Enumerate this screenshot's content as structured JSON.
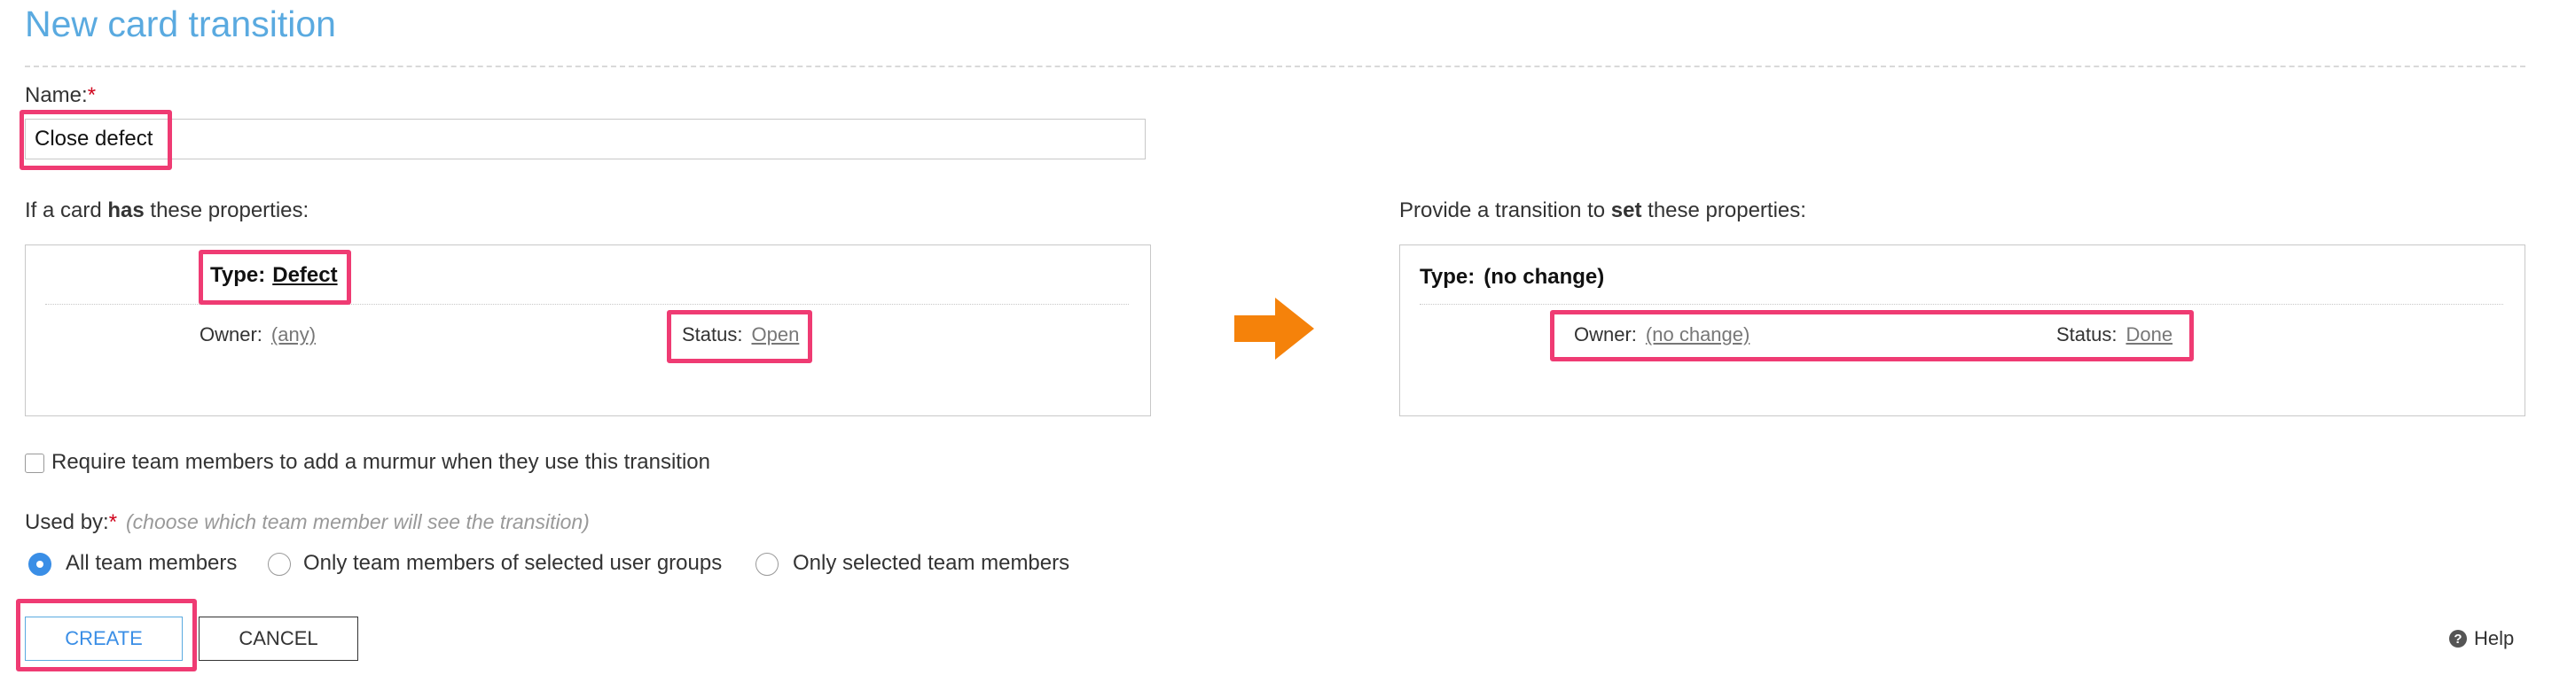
{
  "page": {
    "title": "New card transition"
  },
  "name_field": {
    "label": "Name:",
    "required_mark": "*",
    "value": "Close defect"
  },
  "if_section": {
    "label_before": "If a card ",
    "label_bold": "has",
    "label_after": " these properties:",
    "type_label": "Type:",
    "type_value": "Defect",
    "owner_label": "Owner:",
    "owner_value": "(any)",
    "status_label": "Status:",
    "status_value": "Open"
  },
  "set_section": {
    "label_before": "Provide a transition to ",
    "label_bold": "set",
    "label_after": " these properties:",
    "type_label": "Type:",
    "type_value": "(no change)",
    "owner_label": "Owner:",
    "owner_value": "(no change)",
    "status_label": "Status:",
    "status_value": "Done"
  },
  "murmur": {
    "label": "Require team members to add a murmur when they use this transition",
    "checked": false
  },
  "used_by": {
    "label": "Used by:",
    "required_mark": "*",
    "hint": "(choose which team member will see the transition)",
    "options": [
      {
        "label": "All team members",
        "selected": true
      },
      {
        "label": "Only team members of selected user groups",
        "selected": false
      },
      {
        "label": "Only selected team members",
        "selected": false
      }
    ]
  },
  "actions": {
    "create_label": "CREATE",
    "cancel_label": "CANCEL",
    "help_label": "Help"
  },
  "colors": {
    "title": "#5aaae0",
    "highlight": "#ef3b73",
    "arrow": "#f5820a",
    "radio_selected": "#3a8ee6",
    "required": "#d0021b"
  },
  "icons": {
    "arrow": "right-arrow-icon",
    "help": "question-circle-icon"
  }
}
